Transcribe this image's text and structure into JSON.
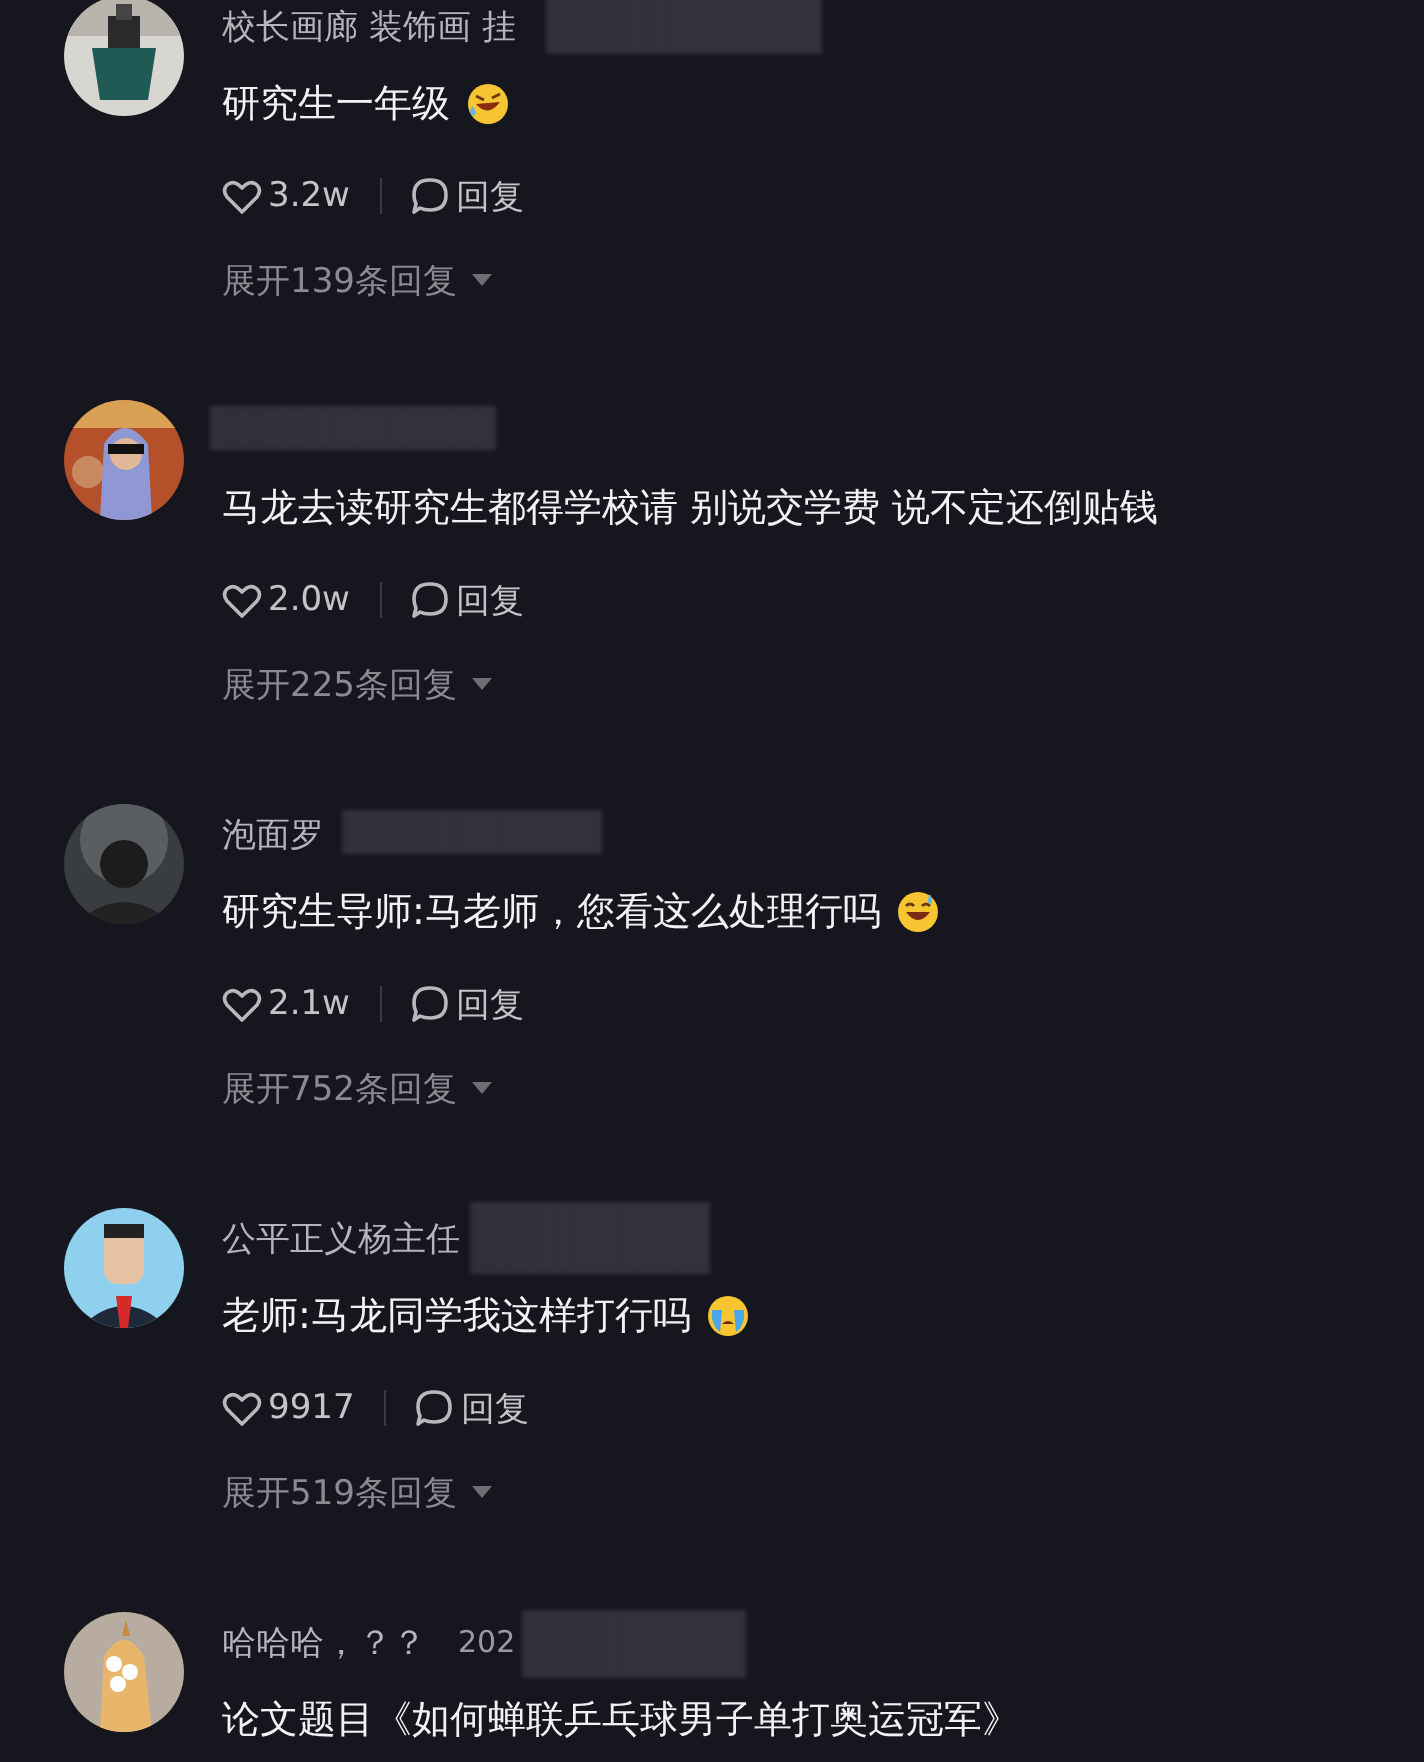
{
  "comments": [
    {
      "name": "校长画廊 装饰画 挂",
      "name_redacted": true,
      "text": "研究生一年级",
      "emoji": {
        "kind": "laughing"
      },
      "likes": "3.2w",
      "reply": "回复",
      "expand": "展开139条回复"
    },
    {
      "name_redacted": true,
      "text": "马龙去读研究生都得学校请 别说交学费 说不定还倒贴钱",
      "likes": "2.0w",
      "reply": "回复",
      "expand": "展开225条回复"
    },
    {
      "name": "泡面罗",
      "name_redacted": true,
      "text": "研究生导师:马老师，您看这么处理行吗",
      "emoji": {
        "kind": "grinning_sweat"
      },
      "likes": "2.1w",
      "reply": "回复",
      "expand": "展开752条回复"
    },
    {
      "name": "公平正义杨主任",
      "name_redacted": true,
      "text": "老师:马龙同学我这样打行吗",
      "emoji": {
        "kind": "crying"
      },
      "likes": "9917",
      "reply": "回复",
      "expand": "展开519条回复"
    },
    {
      "name": "哈哈哈，？？",
      "date": "202",
      "name_redacted": true,
      "text": "论文题目《如何蝉联乒乓球男子单打奥运冠军》"
    }
  ]
}
